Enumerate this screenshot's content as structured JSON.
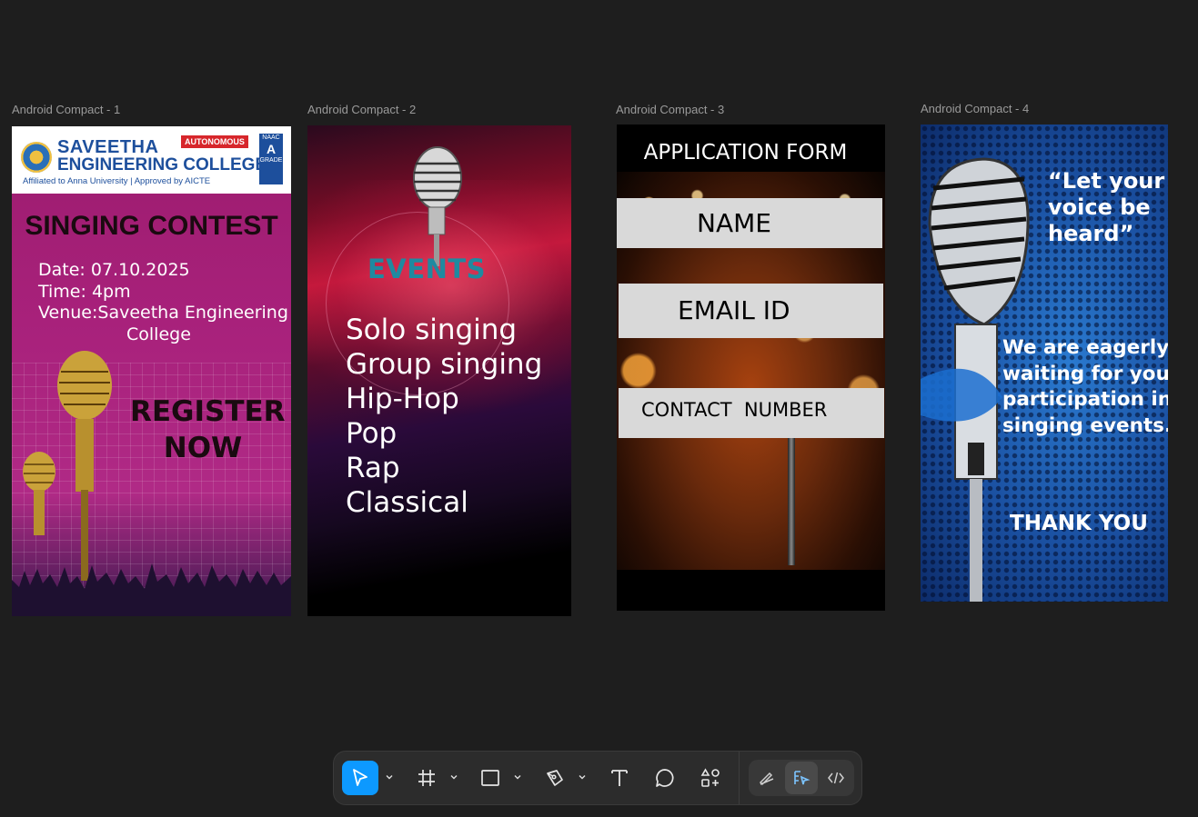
{
  "canvas": {
    "frames": [
      {
        "label": "Android Compact - 1"
      },
      {
        "label": "Android Compact - 2"
      },
      {
        "label": "Android Compact - 3"
      },
      {
        "label": "Android Compact - 4"
      }
    ]
  },
  "frame1": {
    "college_line1": "SAVEETHA",
    "college_line2": "ENGINEERING COLLEGE",
    "affiliation": "Affiliated to Anna University | Approved by AICTE",
    "autonomous_badge": "AUTONOMOUS",
    "naac_top": "NAAC",
    "naac_grade": "A",
    "naac_bottom": "GRADE",
    "title": "SINGING CONTEST",
    "date": "Date: 07.10.2025",
    "time": "Time: 4pm",
    "venue_line1": "Venue:Saveetha Engineering",
    "venue_line2": "College",
    "register_line1": "REGISTER",
    "register_line2": "NOW"
  },
  "frame2": {
    "heading": "EVENTS",
    "events": [
      "Solo singing",
      "Group singing",
      "Hip-Hop",
      "Pop",
      "Rap",
      "Classical"
    ]
  },
  "frame3": {
    "title": "APPLICATION FORM",
    "name_field": "NAME",
    "email_field": "EMAIL ID",
    "contact_field": "CONTACT  NUMBER"
  },
  "frame4": {
    "quote": "“Let your voice be heard”",
    "quote_lines": [
      "“Let your",
      "voice be",
      " heard”"
    ],
    "message_lines": [
      "We are eagerly",
      "waiting for your",
      "participation in",
      "singing events."
    ],
    "thanks": "THANK YOU"
  },
  "toolbar": {
    "tools": [
      "move-tool",
      "frame-tool",
      "rectangle-tool",
      "pen-tool",
      "text-tool",
      "comment-tool",
      "actions-tool"
    ],
    "modes": [
      "draw-mode",
      "design-mode",
      "dev-mode"
    ],
    "active_tool": "move-tool",
    "active_mode": "design-mode",
    "accent_color": "#0d99ff"
  }
}
